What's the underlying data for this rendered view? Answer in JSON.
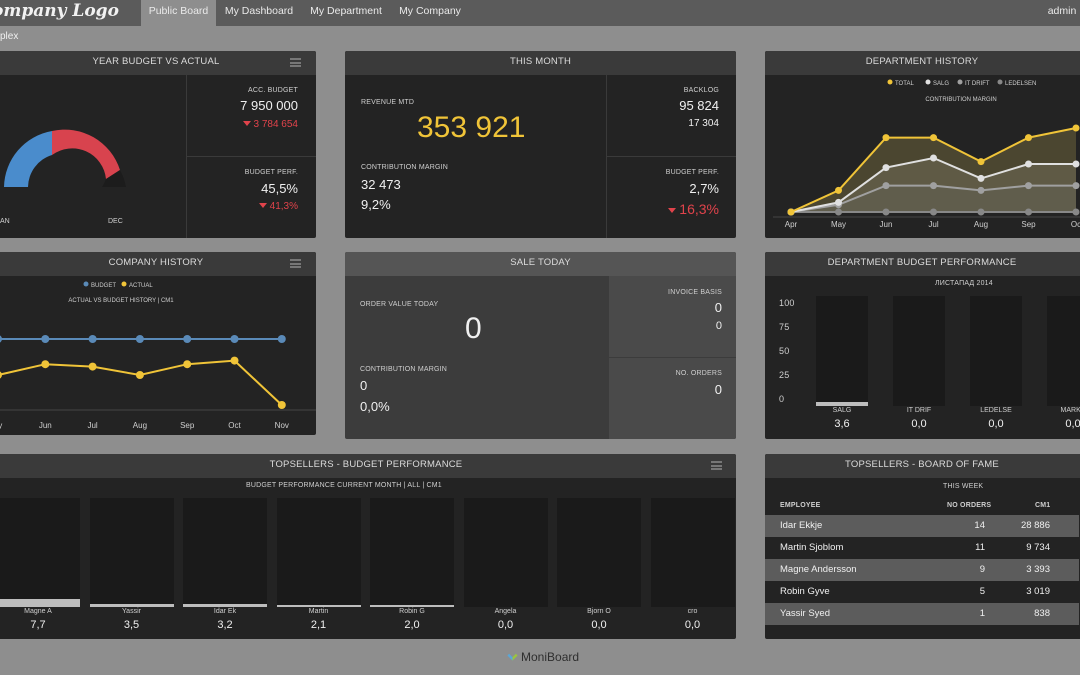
{
  "nav": {
    "logo": "ompany Logo",
    "items": [
      "Public Board",
      "My Dashboard",
      "My Department",
      "My Company"
    ],
    "user": "admin"
  },
  "subbar": {
    "label": "plex"
  },
  "year_budget": {
    "title": "YEAR BUDGET VS ACTUAL",
    "acc_budget_label": "ACC. BUDGET",
    "acc_budget_value": "7 950 000",
    "acc_budget_delta": "3 784 654",
    "budget_perf_label": "BUDGET PERF.",
    "budget_perf_value": "45,5%",
    "budget_perf_delta": "41,3%",
    "gauge_start": "AN",
    "gauge_end": "DEC"
  },
  "this_month": {
    "title": "THIS MONTH",
    "revenue_label": "REVENUE MTD",
    "revenue_value": "353 921",
    "cm_label": "CONTRIBUTION MARGIN",
    "cm_value": "32 473",
    "cm_pct": "9,2%",
    "backlog_label": "BACKLOG",
    "backlog_value": "95 824",
    "backlog_sub": "17 304",
    "budget_perf_label": "BUDGET PERF.",
    "budget_perf_value": "2,7%",
    "budget_perf_delta": "16,3%"
  },
  "dept_history": {
    "title": "DEPARTMENT HISTORY",
    "subtitle": "CONTRIBUTION MARGIN",
    "legend": [
      "TOTAL",
      "SALG",
      "IT DRIFT",
      "LEDELSEN"
    ]
  },
  "company_history": {
    "title": "COMPANY HISTORY",
    "subtitle": "ACTUAL VS BUDGET HISTORY | CM1",
    "legend": [
      "BUDGET",
      "ACTUAL"
    ]
  },
  "sale_today": {
    "title": "SALE TODAY",
    "order_label": "ORDER VALUE TODAY",
    "order_value": "0",
    "cm_label": "CONTRIBUTION MARGIN",
    "cm_value": "0",
    "cm_pct": "0,0%",
    "invoice_label": "INVOICE BASIS",
    "invoice_value": "0",
    "invoice_sub": "0",
    "orders_label": "NO. ORDERS",
    "orders_value": "0"
  },
  "dept_budget": {
    "title": "DEPARTMENT BUDGET PERFORMANCE",
    "subtitle": "ЛИСТАПАД 2014",
    "y_ticks": [
      "100",
      "75",
      "50",
      "25",
      "0"
    ],
    "bars": [
      {
        "name": "SALG",
        "value": "3,6",
        "fill": 3.6
      },
      {
        "name": "IT DRIF",
        "value": "0,0",
        "fill": 0
      },
      {
        "name": "LEDELSE",
        "value": "0,0",
        "fill": 0
      },
      {
        "name": "MARKE",
        "value": "0,0",
        "fill": 0
      }
    ]
  },
  "topsellers_budget": {
    "title": "TOPSELLERS - BUDGET PERFORMANCE",
    "subtitle": "BUDGET PERFORMANCE CURRENT MONTH | ALL | CM1",
    "bars": [
      {
        "name": "Magne A",
        "value": "7,7",
        "fill": 7.7
      },
      {
        "name": "Yassir",
        "value": "3,5",
        "fill": 3.5
      },
      {
        "name": "Idar Ek",
        "value": "3,2",
        "fill": 3.2
      },
      {
        "name": "Martin",
        "value": "2,1",
        "fill": 2.1
      },
      {
        "name": "Robin G",
        "value": "2,0",
        "fill": 2.0
      },
      {
        "name": "Angela",
        "value": "0,0",
        "fill": 0
      },
      {
        "name": "Bjorn O",
        "value": "0,0",
        "fill": 0
      },
      {
        "name": "cro",
        "value": "0,0",
        "fill": 0
      }
    ]
  },
  "board_of_fame": {
    "title": "TOPSELLERS - BOARD OF FAME",
    "subtitle": "THIS WEEK",
    "columns": [
      "EMPLOYEE",
      "NO ORDERS",
      "CM1"
    ],
    "rows": [
      {
        "name": "Idar Ekkje",
        "orders": "14",
        "cm1": "28 886"
      },
      {
        "name": "Martin Sjoblom",
        "orders": "11",
        "cm1": "9 734"
      },
      {
        "name": "Magne Andersson",
        "orders": "9",
        "cm1": "3 393"
      },
      {
        "name": "Robin Gyve",
        "orders": "5",
        "cm1": "3 019"
      },
      {
        "name": "Yassir Syed",
        "orders": "1",
        "cm1": "838"
      }
    ]
  },
  "footer": {
    "brand": "MoniBoard"
  },
  "colors": {
    "accent_yellow": "#f0c438",
    "negative_red": "#e0434b",
    "budget_blue": "#5a8ab8",
    "gauge_blue": "#4a8ccc",
    "gauge_red": "#d8434e"
  },
  "chart_data": [
    {
      "type": "line",
      "x": [
        "Apr",
        "May",
        "Jun",
        "Jul",
        "Aug",
        "Sep",
        "Oct"
      ],
      "series": [
        {
          "name": "TOTAL",
          "values": [
            0,
            18,
            62,
            62,
            42,
            62,
            70
          ]
        },
        {
          "name": "SALG",
          "values": [
            0,
            8,
            37,
            45,
            28,
            40,
            40
          ]
        },
        {
          "name": "IT DRIFT",
          "values": [
            0,
            6,
            22,
            22,
            18,
            22,
            22
          ]
        },
        {
          "name": "LEDELSEN",
          "values": [
            0,
            0,
            0,
            0,
            0,
            0,
            0
          ]
        }
      ],
      "x_axis_labels": [
        "Apr",
        "May",
        "Jun",
        "Jul",
        "Aug",
        "Sep",
        "Oc"
      ]
    },
    {
      "type": "line",
      "x": [
        "May",
        "Jun",
        "Jul",
        "Aug",
        "Sep",
        "Oct",
        "Nov"
      ],
      "series": [
        {
          "name": "BUDGET",
          "values": [
            55,
            55,
            55,
            55,
            55,
            55,
            55
          ]
        },
        {
          "name": "ACTUAL",
          "values": [
            25,
            34,
            32,
            25,
            34,
            37,
            0
          ]
        }
      ],
      "x_axis_labels": [
        "ay",
        "Jun",
        "Jul",
        "Aug",
        "Sep",
        "Oct",
        "Nov"
      ]
    },
    {
      "type": "pie",
      "title": "YEAR BUDGET VS ACTUAL",
      "values": [
        45.5,
        54.5
      ]
    }
  ]
}
